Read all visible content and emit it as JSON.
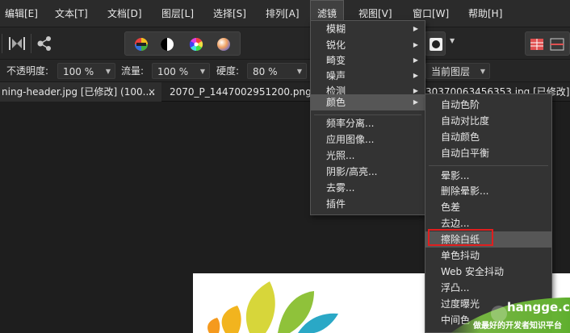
{
  "menubar": {
    "items": [
      "编辑[E]",
      "文本[T]",
      "文档[D]",
      "图层[L]",
      "选择[S]",
      "排列[A]",
      "滤镜",
      "视图[V]",
      "窗口[W]",
      "帮助[H]"
    ]
  },
  "context": {
    "opacity_label": "不透明度:",
    "opacity_value": "100 %",
    "flow_label": "流量:",
    "flow_value": "100 %",
    "hardness_label": "硬度:",
    "hardness_value": "80 %",
    "layer_value": "当前图层"
  },
  "tabs": [
    {
      "label": "ning-header.jpg [已修改] (100...."
    },
    {
      "label": "2070_P_1447002951200.png [已修"
    },
    {
      "label": "30370063456353.jpg [已修改] (1"
    }
  ],
  "tab_close": "×",
  "filter_menu": {
    "items": [
      {
        "label": "模糊",
        "submenu": true
      },
      {
        "label": "锐化",
        "submenu": true
      },
      {
        "label": "畸变",
        "submenu": true
      },
      {
        "label": "噪声",
        "submenu": true
      },
      {
        "label": "检测",
        "submenu": true
      },
      {
        "label": "颜色",
        "submenu": true
      },
      {
        "label": "频率分离..."
      },
      {
        "label": "应用图像..."
      },
      {
        "label": "光照..."
      },
      {
        "label": "阴影/高亮..."
      },
      {
        "label": "去雾..."
      },
      {
        "label": "插件"
      }
    ],
    "arrow": "▶"
  },
  "color_submenu": {
    "items": [
      "自动色阶",
      "自动对比度",
      "自动颜色",
      "自动白平衡",
      "晕影...",
      "删除晕影...",
      "色差",
      "去边...",
      "擦除白纸",
      "单色抖动",
      "Web 安全抖动",
      "浮凸...",
      "过度曝光",
      "中间色"
    ],
    "highlighted": "擦除白纸"
  },
  "watermark": {
    "site": "hangge.com",
    "tagline": "做最好的开发者知识平台"
  },
  "colors": {
    "accent_red": "#e01e1e",
    "watermark_green": "#7cc242"
  },
  "icons": [
    "align-icon",
    "share-node-icon",
    "color-wheel-icon",
    "contrast-icon",
    "hue-icon",
    "gradient-ball-icon",
    "dropdown-icon",
    "grid-icon"
  ]
}
